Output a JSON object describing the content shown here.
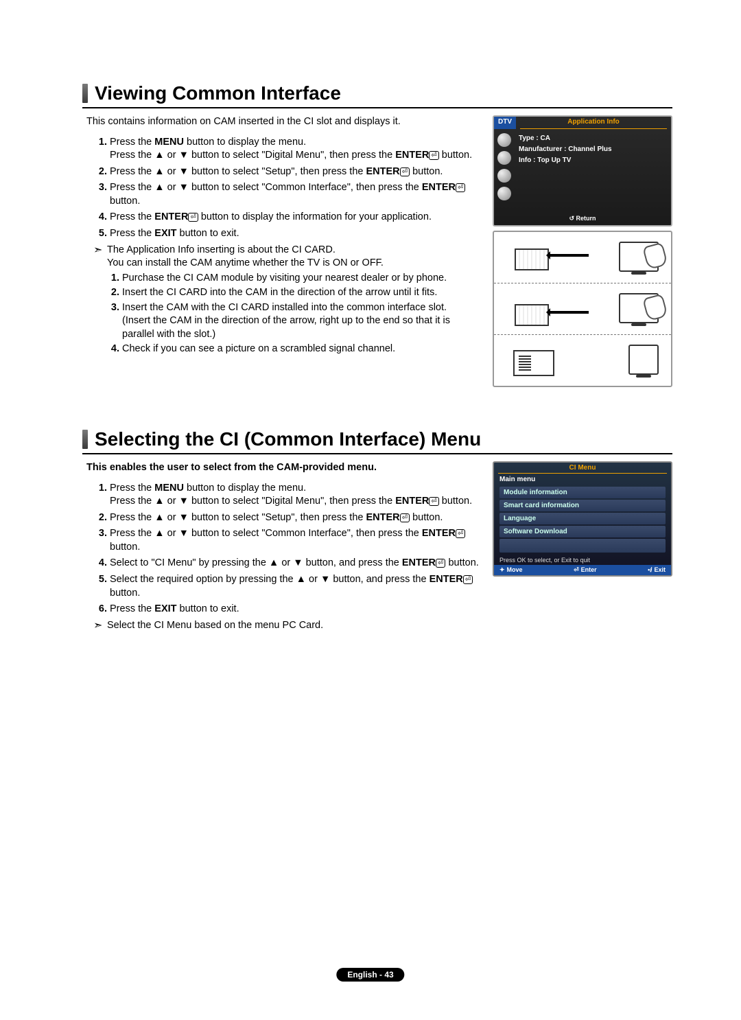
{
  "section1": {
    "title": "Viewing Common Interface",
    "intro": "This contains information on CAM inserted in the CI slot and displays it.",
    "steps": {
      "s1a": "Press the ",
      "s1b": "MENU",
      "s1c": " button to display the menu.",
      "s1d": "Press the ▲ or ▼ button to select \"Digital Menu\", then press the ",
      "s1e": "ENTER",
      "s1f": " button.",
      "s2a": "Press the ▲ or ▼ button to select \"Setup\", then press the ",
      "s2b": "ENTER",
      "s2c": " button.",
      "s3a": "Press the ▲ or ▼ button to select \"Common Interface\", then press the ",
      "s3b": "ENTER",
      "s3c": " button.",
      "s4a": "Press the ",
      "s4b": "ENTER",
      "s4c": " button to display the information for your application.",
      "s5a": "Press the ",
      "s5b": "EXIT",
      "s5c": " button to exit."
    },
    "note": {
      "l1": "The Application Info inserting is about the CI CARD.",
      "l2": "You can install the CAM anytime whether the TV is ON or OFF."
    },
    "substeps": {
      "ss1": "Purchase the CI CAM module by visiting your nearest dealer or by phone.",
      "ss2": "Insert the CI CARD into the CAM in the direction of the arrow until it fits.",
      "ss3a": "Insert the CAM with the CI CARD installed into the common interface slot.",
      "ss3b": "(Insert the CAM in the direction of the arrow, right up to the end so that it is parallel with the slot.)",
      "ss4": "Check if you can see a picture on a scrambled signal channel."
    }
  },
  "dtv": {
    "tag": "DTV",
    "header": "Application Info",
    "line1": "Type : CA",
    "line2": "Manufacturer : Channel Plus",
    "line3": "Info : Top Up TV",
    "return": "Return"
  },
  "section2": {
    "title": "Selecting the CI (Common Interface) Menu",
    "intro": "This enables the user to select from the CAM-provided menu.",
    "steps": {
      "s1a": "Press the ",
      "s1b": "MENU",
      "s1c": " button to display the menu.",
      "s1d": "Press the ▲ or ▼ button to select \"Digital Menu\", then press the ",
      "s1e": "ENTER",
      "s1f": " button.",
      "s2a": "Press the ▲ or ▼ button to select \"Setup\", then press the ",
      "s2b": "ENTER",
      "s2c": " button.",
      "s3a": "Press the ▲ or ▼ button to select \"Common Interface\", then press the ",
      "s3b": "ENTER",
      "s3c": " button.",
      "s4a": "Select to \"CI Menu\" by pressing the ▲ or ▼ button, and press the ",
      "s4b": "ENTER",
      "s4c": " button.",
      "s5a": "Select the required option by pressing the ▲ or ▼ button, and press the ",
      "s5b": "ENTER",
      "s5c": " button.",
      "s6a": "Press the ",
      "s6b": "EXIT",
      "s6c": " button to exit."
    },
    "note": "Select the CI Menu based on the menu PC Card."
  },
  "cimenu": {
    "title": "CI Menu",
    "main": "Main menu",
    "items": [
      "Module information",
      "Smart card information",
      "Language",
      "Software Download"
    ],
    "prompt": "Press OK to select, or Exit to quit",
    "footer": {
      "move": "Move",
      "enter": "Enter",
      "exit": "Exit"
    }
  },
  "footer": "English - 43"
}
